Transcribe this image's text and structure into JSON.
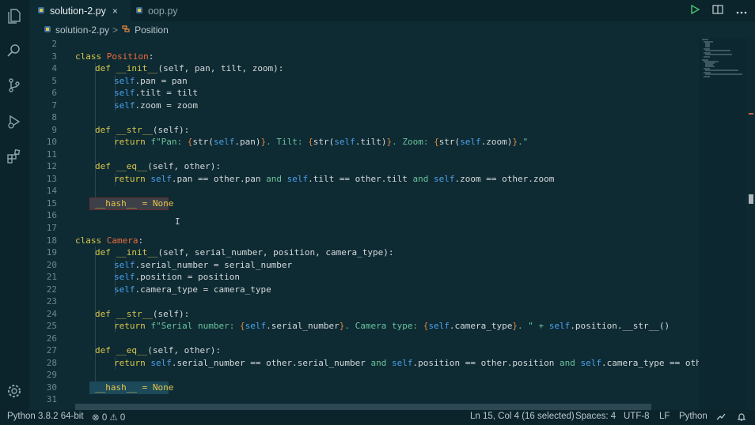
{
  "tabs": [
    {
      "label": "solution-2.py",
      "active": true,
      "close": "×"
    },
    {
      "label": "oop.py",
      "active": false
    }
  ],
  "breadcrumb": {
    "file": "solution-2.py",
    "sep": ">",
    "symbol": "Position"
  },
  "code_lines": [
    {
      "n": "2"
    },
    {
      "n": "3"
    },
    {
      "n": "4"
    },
    {
      "n": "5"
    },
    {
      "n": "6"
    },
    {
      "n": "7"
    },
    {
      "n": "8"
    },
    {
      "n": "9"
    },
    {
      "n": "10"
    },
    {
      "n": "11"
    },
    {
      "n": "12"
    },
    {
      "n": "13"
    },
    {
      "n": "14"
    },
    {
      "n": "15"
    },
    {
      "n": "16"
    },
    {
      "n": "17"
    },
    {
      "n": "18"
    },
    {
      "n": "19"
    },
    {
      "n": "20"
    },
    {
      "n": "21"
    },
    {
      "n": "22"
    },
    {
      "n": "23"
    },
    {
      "n": "24"
    },
    {
      "n": "25"
    },
    {
      "n": "26"
    },
    {
      "n": "27"
    },
    {
      "n": "28"
    },
    {
      "n": "29"
    },
    {
      "n": "30"
    },
    {
      "n": "31"
    }
  ],
  "code": {
    "l3": [
      "class ",
      "Position",
      ":"
    ],
    "l4": [
      "def ",
      "__init__",
      "(self, pan, tilt, zoom):"
    ],
    "l5": [
      "self",
      ".pan = pan"
    ],
    "l6": [
      "self",
      ".tilt = tilt"
    ],
    "l7": [
      "self",
      ".zoom = zoom"
    ],
    "l9": [
      "def ",
      "__str__",
      "(self):"
    ],
    "l10": [
      "return ",
      "f\"Pan: ",
      "{",
      "str(",
      "self",
      ".pan)",
      "}",
      ". Tilt: ",
      "{",
      "str(",
      "self",
      ".tilt)",
      "}",
      ". Zoom: ",
      "{",
      "str(",
      "self",
      ".zoom)",
      "}",
      ".\""
    ],
    "l12": [
      "def ",
      "__eq__",
      "(self, other):"
    ],
    "l13": [
      "return ",
      "self",
      ".pan == other.pan ",
      "and ",
      "self",
      ".tilt == other.tilt ",
      "and ",
      "self",
      ".zoom == other.zoom"
    ],
    "l15": [
      "__hash__ = None"
    ],
    "l18": [
      "class ",
      "Camera",
      ":"
    ],
    "l19": [
      "def ",
      "__init__",
      "(self, serial_number, position, camera_type):"
    ],
    "l20": [
      "self",
      ".serial_number = serial_number"
    ],
    "l21": [
      "self",
      ".position = position"
    ],
    "l22": [
      "self",
      ".camera_type = camera_type"
    ],
    "l24": [
      "def ",
      "__str__",
      "(self):"
    ],
    "l25": [
      "return ",
      "f\"Serial number: ",
      "{",
      "self",
      ".serial_number",
      "}",
      ". Camera type: ",
      "{",
      "self",
      ".camera_type",
      "}",
      ". \" + ",
      "self",
      ".position.__str__()"
    ],
    "l27": [
      "def ",
      "__eq__",
      "(self, other):"
    ],
    "l28": [
      "return ",
      "self",
      ".serial_number == other.serial_number ",
      "and ",
      "self",
      ".position == other.position ",
      "and ",
      "self",
      ".camera_type == other.came"
    ],
    "l30": [
      "__hash__ = None"
    ]
  },
  "status": {
    "python": "Python 3.8.2 64-bit",
    "problems": "⊗ 0 ⚠ 0",
    "cursor": "Ln 15, Col 4 (16 selected)",
    "spaces": "Spaces: 4",
    "encoding": "UTF-8",
    "eol": "LF",
    "language": "Python"
  },
  "icons": [
    "files-icon",
    "search-icon",
    "source-control-icon",
    "run-debug-icon",
    "extensions-icon",
    "settings-gear-icon",
    "run-icon",
    "split-editor-icon",
    "more-icon",
    "feedback-icon",
    "bell-icon"
  ]
}
